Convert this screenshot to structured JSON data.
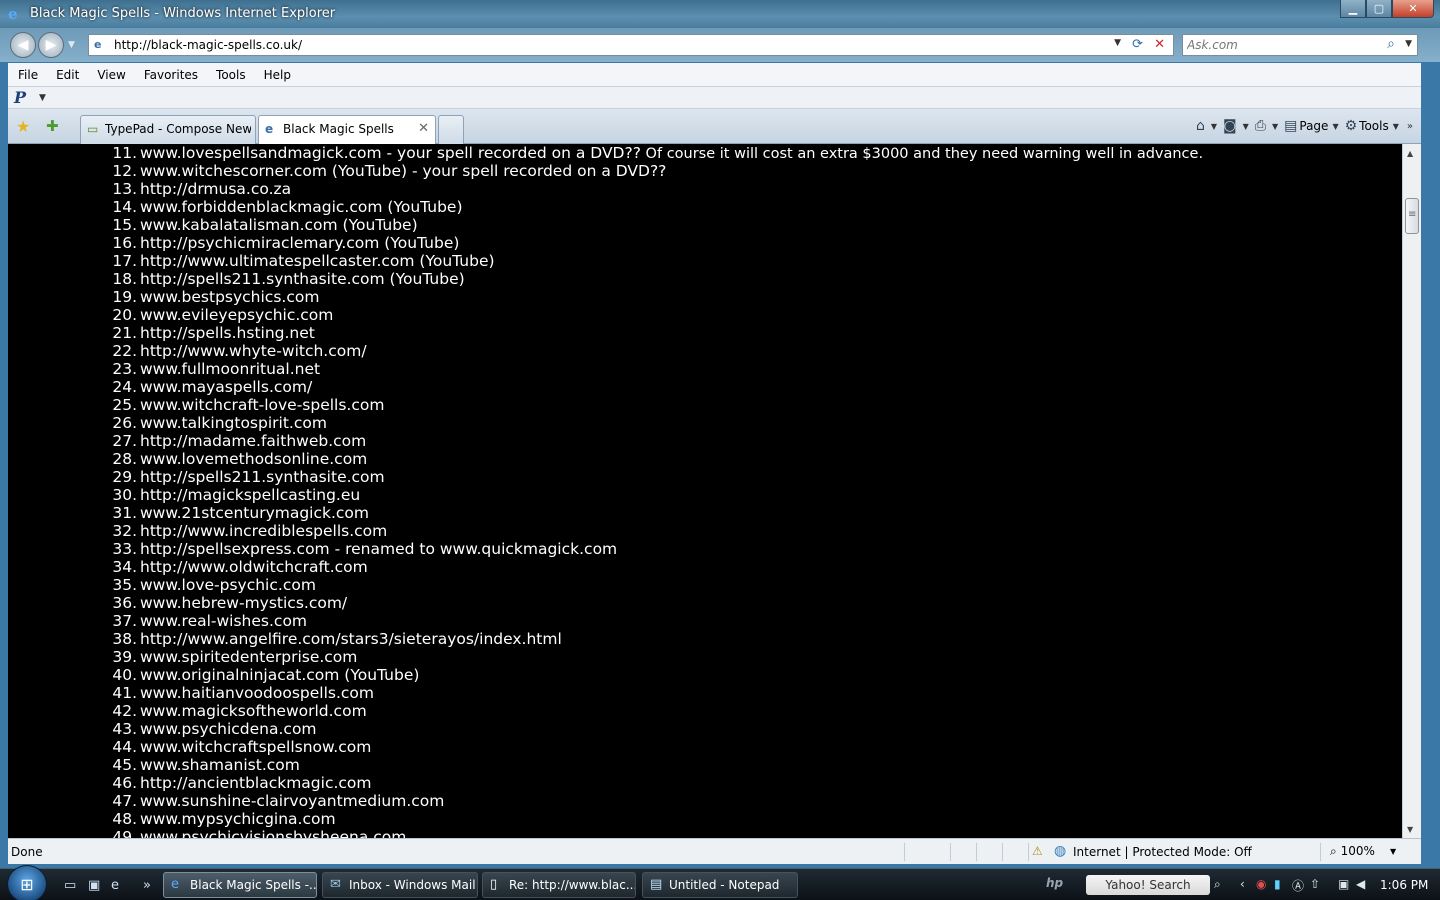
{
  "window": {
    "title": "Black Magic Spells - Windows Internet Explorer"
  },
  "address": {
    "url": "http://black-magic-spells.co.uk/"
  },
  "search": {
    "placeholder": "Ask.com"
  },
  "menu": [
    "File",
    "Edit",
    "View",
    "Favorites",
    "Tools",
    "Help"
  ],
  "tabs": [
    {
      "label": "TypePad - Compose New ...",
      "active": false
    },
    {
      "label": "Black Magic Spells",
      "active": true
    }
  ],
  "commandbar": {
    "page_label": "Page",
    "tools_label": "Tools"
  },
  "content": {
    "items": [
      {
        "num": "11.",
        "text": "www.lovespellsandmagick.com - your spell recorded on a DVD??",
        "note": " Of course it will cost an extra $3000 and they need warning well in advance."
      },
      {
        "num": "12.",
        "text": "www.witchescorner.com (YouTube) - your spell recorded on a DVD??"
      },
      {
        "num": "13.",
        "text": "http://drmusa.co.za"
      },
      {
        "num": "14.",
        "text": "www.forbiddenblackmagic.com (YouTube)"
      },
      {
        "num": "15.",
        "text": "www.kabalatalisman.com (YouTube)"
      },
      {
        "num": "16.",
        "text": "http://psychicmiraclemary.com (YouTube)"
      },
      {
        "num": "17.",
        "text": "http://www.ultimatespellcaster.com (YouTube)"
      },
      {
        "num": "18.",
        "text": "http://spells211.synthasite.com (YouTube)"
      },
      {
        "num": "19.",
        "text": "www.bestpsychics.com"
      },
      {
        "num": "20.",
        "text": "www.evileyepsychic.com"
      },
      {
        "num": "21.",
        "text": "http://spells.hsting.net"
      },
      {
        "num": "22.",
        "text": "http://www.whyte-witch.com/"
      },
      {
        "num": "23.",
        "text": "www.fullmoonritual.net"
      },
      {
        "num": "24.",
        "text": "www.mayaspells.com/"
      },
      {
        "num": "25.",
        "text": "www.witchcraft-love-spells.com"
      },
      {
        "num": "26.",
        "text": "www.talkingtospirit.com"
      },
      {
        "num": "27.",
        "text": "http://madame.faithweb.com"
      },
      {
        "num": "28.",
        "text": "www.lovemethodsonline.com"
      },
      {
        "num": "29.",
        "text": "http://spells211.synthasite.com"
      },
      {
        "num": "30.",
        "text": "http://magickspellcasting.eu"
      },
      {
        "num": "31.",
        "text": "www.21stcenturymagick.com"
      },
      {
        "num": "32.",
        "text": "http://www.incrediblespells.com"
      },
      {
        "num": "33.",
        "text": "http://spellsexpress.com - renamed to www.quickmagick.com"
      },
      {
        "num": "34.",
        "text": "http://www.oldwitchcraft.com"
      },
      {
        "num": "35.",
        "text": "www.love-psychic.com"
      },
      {
        "num": "36.",
        "text": "www.hebrew-mystics.com/"
      },
      {
        "num": "37.",
        "text": "www.real-wishes.com"
      },
      {
        "num": "38.",
        "text": "http://www.angelfire.com/stars3/sieterayos/index.html"
      },
      {
        "num": "39.",
        "text": "www.spiritedenterprise.com"
      },
      {
        "num": "40.",
        "text": "www.originalninjacat.com (YouTube)"
      },
      {
        "num": "41.",
        "text": "www.haitianvoodoospells.com"
      },
      {
        "num": "42.",
        "text": "www.magicksoftheworld.com"
      },
      {
        "num": "43.",
        "text": "www.psychicdena.com"
      },
      {
        "num": "44.",
        "text": "www.witchcraftspellsnow.com"
      },
      {
        "num": "45.",
        "text": "www.shamanist.com"
      },
      {
        "num": "46.",
        "text": "http://ancientblackmagic.com"
      },
      {
        "num": "47.",
        "text": "www.sunshine-clairvoyantmedium.com"
      },
      {
        "num": "48.",
        "text": "www.mypsychicgina.com"
      },
      {
        "num": "49.",
        "text": "www.psychicvisionsbysheena.com"
      }
    ]
  },
  "status": {
    "left": "Done",
    "zone": "Internet | Protected Mode: Off",
    "zoom": "100%"
  },
  "taskbar": {
    "buttons": [
      {
        "label": "Black Magic Spells -...",
        "active": true
      },
      {
        "label": "Inbox - Windows Mail",
        "active": false
      },
      {
        "label": "Re: http://www.blac...",
        "active": false
      },
      {
        "label": "Untitled - Notepad",
        "active": false
      }
    ],
    "hp": "hp",
    "yahoo_search": "Yahoo! Search",
    "clock": "1:06 PM"
  }
}
